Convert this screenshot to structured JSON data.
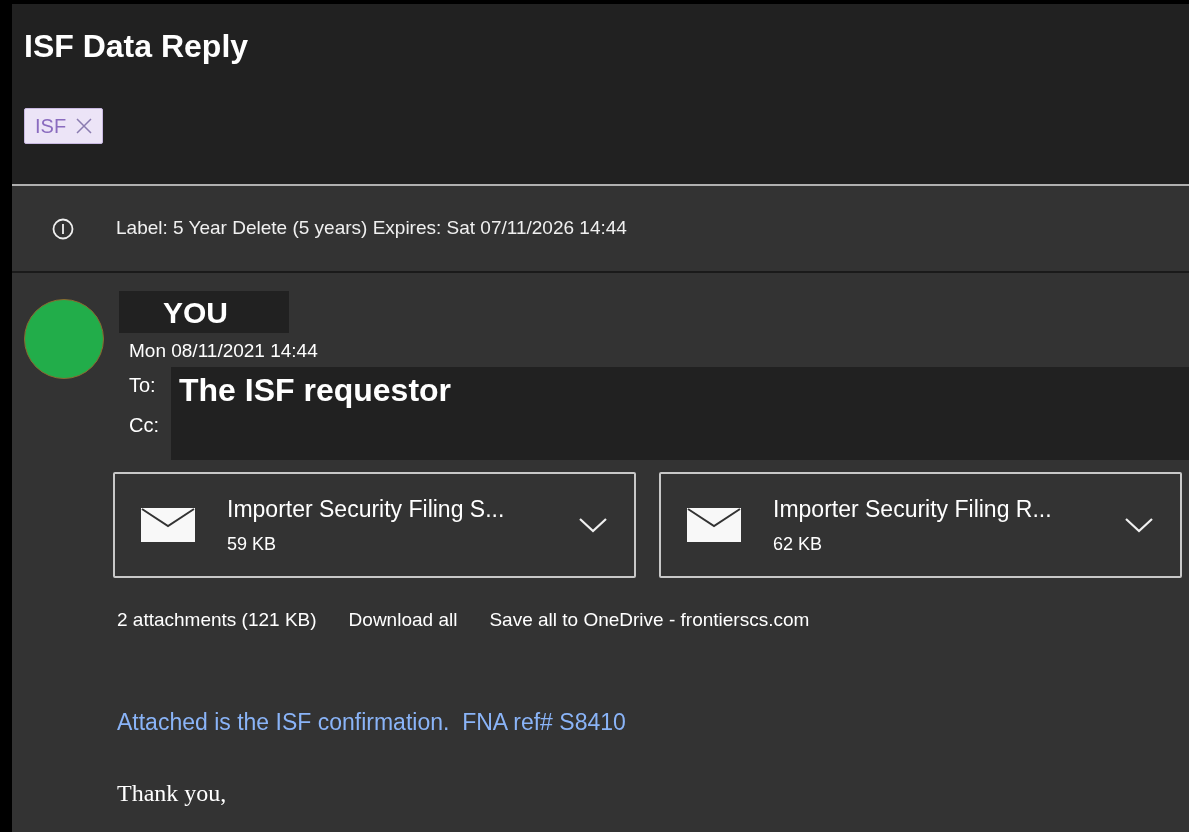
{
  "subject": "ISF Data Reply",
  "categories": [
    {
      "label": "ISF",
      "color": "#ece4f7"
    }
  ],
  "retention_notice": "Label: 5 Year Delete (5 years) Expires: Sat 07/11/2026 14:44",
  "sender": {
    "name": "YOU",
    "date": "Mon 08/11/2021 14:44"
  },
  "to": {
    "label": "To:",
    "value": "The ISF requestor"
  },
  "cc": {
    "label": "Cc:"
  },
  "attachments": [
    {
      "name": "Importer Security Filing S...",
      "size": "59 KB"
    },
    {
      "name": "Importer Security Filing R...",
      "size": "62 KB"
    }
  ],
  "attachment_actions": {
    "summary": "2 attachments (121 KB)",
    "links": [
      "Download all",
      "Save all to OneDrive - frontierscs.com"
    ]
  },
  "body": [
    "Attached is the ISF confirmation.  FNA ref# S8410",
    "Thank you,"
  ]
}
